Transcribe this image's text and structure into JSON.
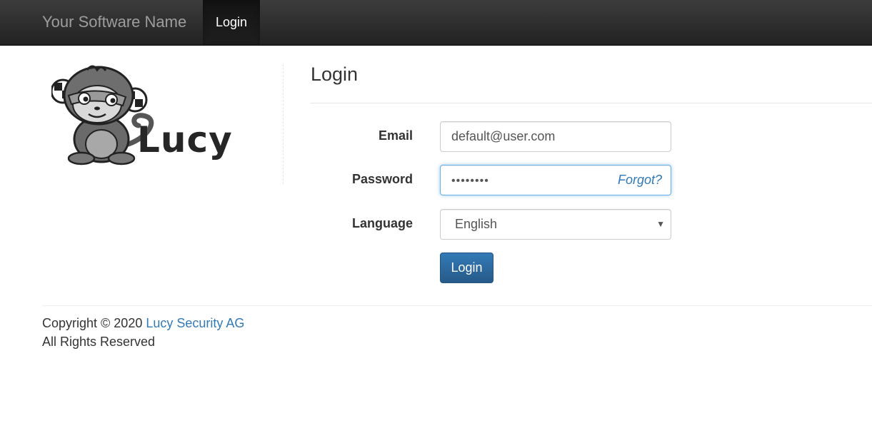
{
  "navbar": {
    "brand": "Your Software Name",
    "active_item": "Login"
  },
  "logo": {
    "text": "Lucy",
    "icon": "monkey-mascot"
  },
  "login": {
    "title": "Login",
    "email": {
      "label": "Email",
      "value": "default@user.com"
    },
    "password": {
      "label": "Password",
      "value": "••••••••",
      "forgot_link": "Forgot?"
    },
    "language": {
      "label": "Language",
      "selected": "English"
    },
    "submit_label": "Login"
  },
  "footer": {
    "copyright_prefix": "Copyright © 2020",
    "company": "Lucy Security AG",
    "rights": "All Rights Reserved"
  },
  "colors": {
    "navbar": "#222222",
    "accent": "#337ab7",
    "text": "#333333"
  }
}
